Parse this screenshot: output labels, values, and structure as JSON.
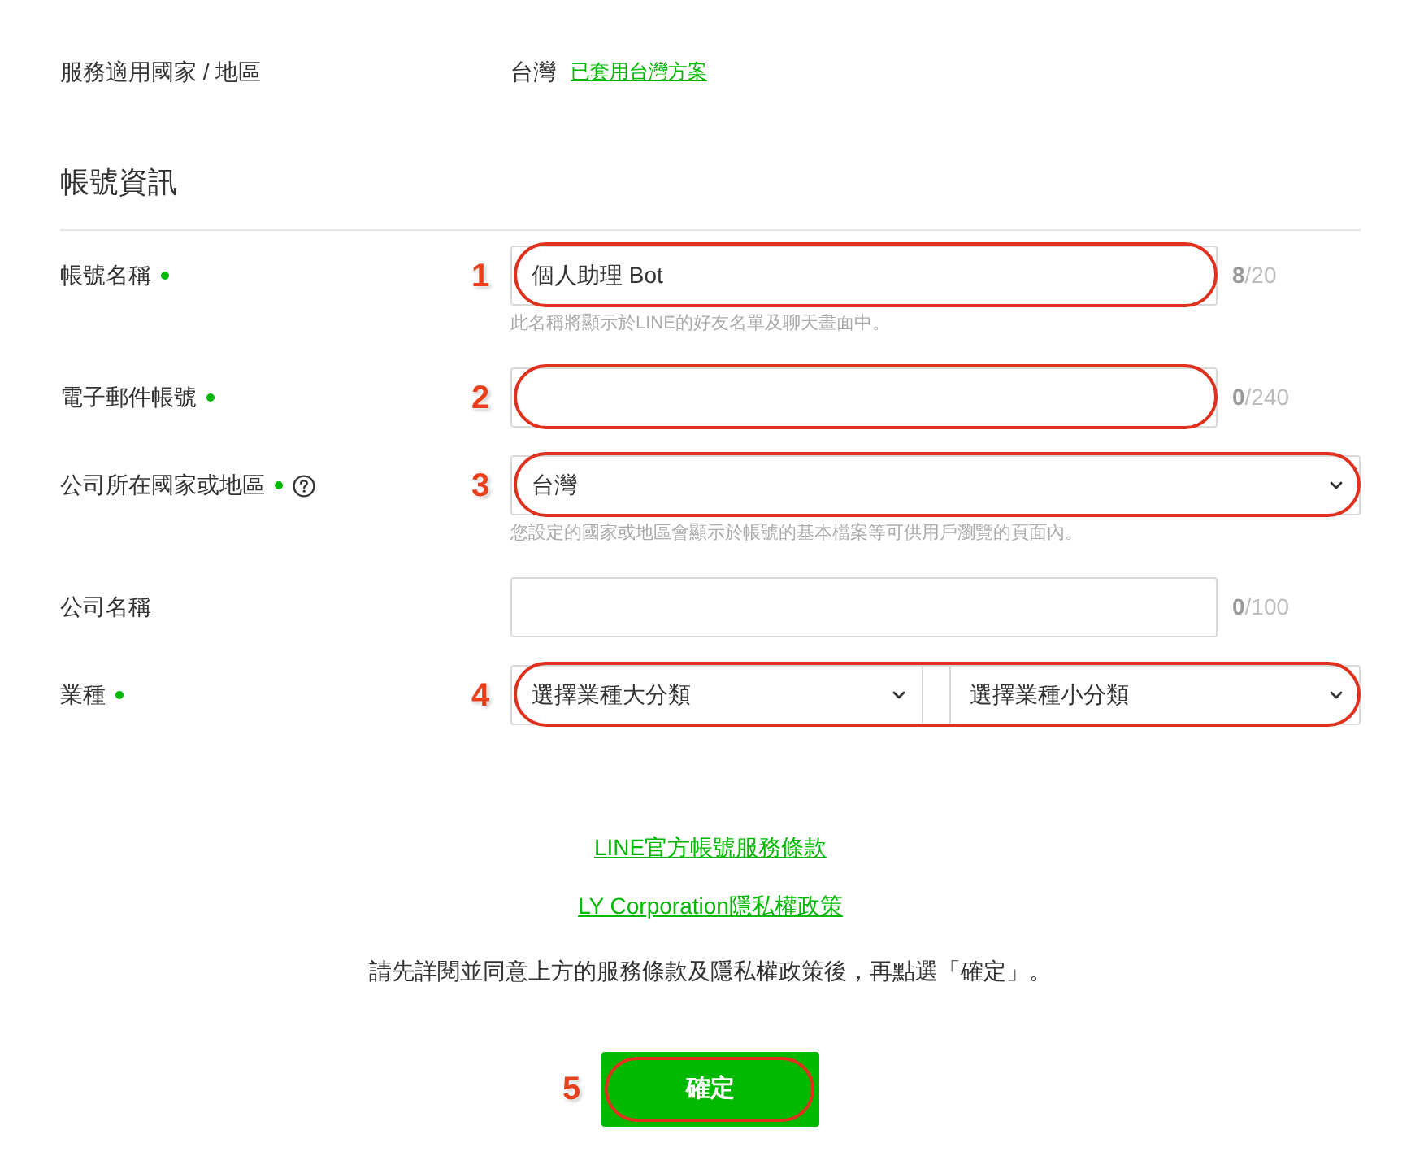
{
  "service_region": {
    "label": "服務適用國家 / 地區",
    "value": "台灣",
    "link": "已套用台灣方案"
  },
  "section_title": "帳號資訊",
  "fields": [
    {
      "kind": "text",
      "label": "帳號名稱",
      "required": true,
      "info": false,
      "value": "個人助理 Bot",
      "counter": "**8**/20",
      "help": "此名稱將顯示於LINE的好友名單及聊天畫面中。",
      "callout": "1"
    },
    {
      "kind": "text",
      "label": "電子郵件帳號",
      "required": true,
      "info": false,
      "counter": "**0**/240",
      "callout": "2"
    },
    {
      "kind": "select",
      "label": "公司所在國家或地區",
      "required": true,
      "info": true,
      "value": "台灣",
      "help": "您設定的國家或地區會顯示於帳號的基本檔案等可供用戶瀏覽的頁面內。",
      "callout": "3"
    },
    {
      "kind": "text",
      "label": "公司名稱",
      "required": false,
      "info": false,
      "counter": "**0**/100"
    },
    {
      "kind": "select_pair",
      "label": "業種",
      "required": true,
      "info": false,
      "options": [
        {
          "value": "選擇業種大分類"
        },
        {
          "value": "選擇業種小分類"
        }
      ],
      "callout": "4"
    }
  ],
  "links": [
    "LINE官方帳號服務條款",
    "LY Corporation隱私權政策"
  ],
  "notice": "請先詳閱並同意上方的服務條款及隱私權政策後，再點選「確定」。",
  "submit": {
    "label": "確定",
    "callout": "5"
  }
}
